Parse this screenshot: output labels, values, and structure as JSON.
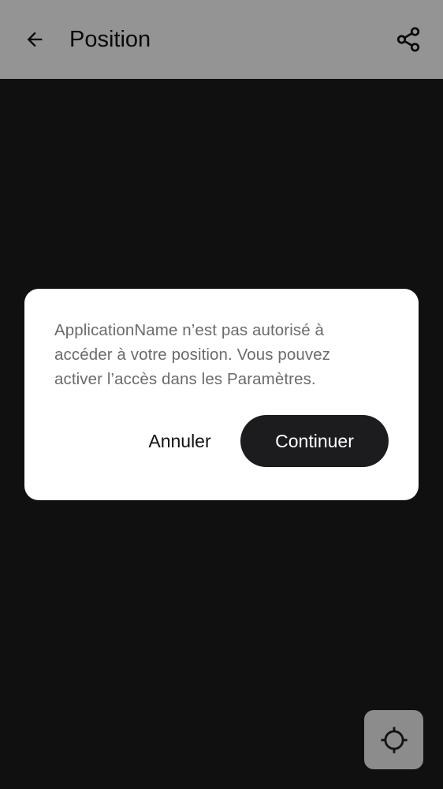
{
  "app_bar": {
    "title": "Position",
    "back_icon": "arrow-left-icon",
    "share_icon": "share-icon"
  },
  "map": {
    "locate_icon": "crosshair-icon"
  },
  "dialog": {
    "message": "ApplicationName n’est pas autorisé à accéder à votre position. Vous pouvez activer l’accès dans les Paramètres.",
    "cancel_label": "Annuler",
    "continue_label": "Continuer"
  },
  "colors": {
    "background": "#1c1c1d",
    "app_bar": "#ffffff",
    "primary_button": "#1c1c1f",
    "message_text": "#6b6b6e"
  }
}
